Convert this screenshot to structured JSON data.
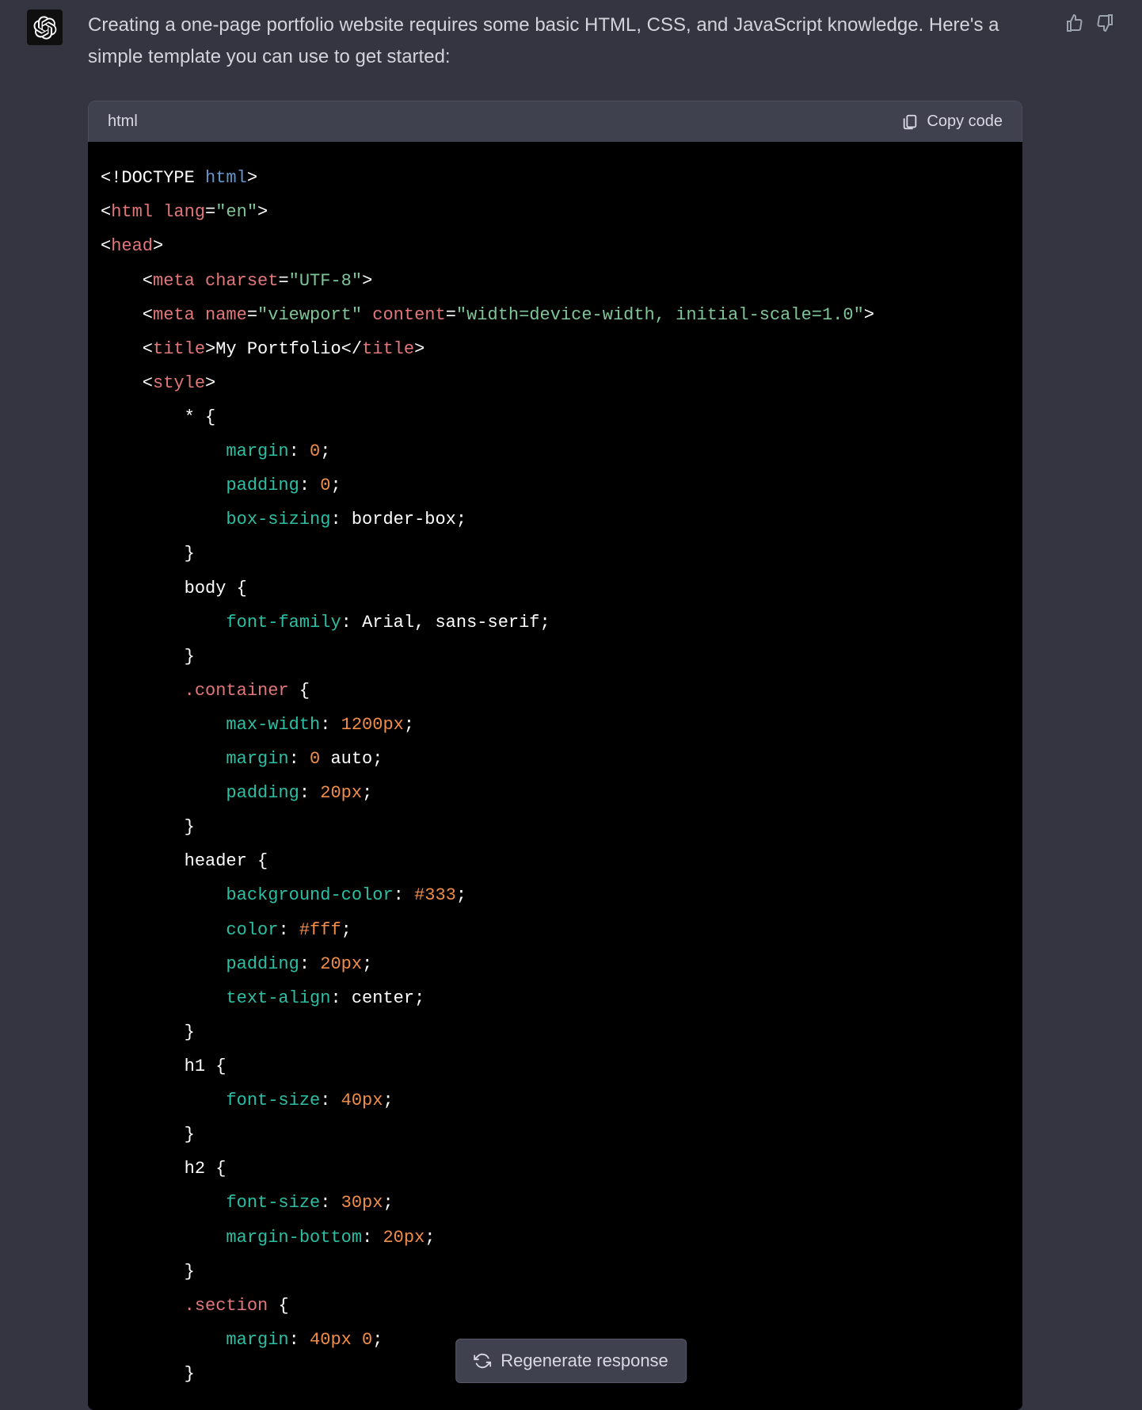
{
  "message": {
    "intro": "Creating a one-page portfolio website requires some basic HTML, CSS, and JavaScript knowledge. Here's a simple template you can use to get started:"
  },
  "code_block": {
    "language": "html",
    "copy_label": "Copy code",
    "lines": {
      "l1_doctype": "<!DOCTYPE",
      "l1_html": " html",
      "l1_end": ">",
      "l2_open": "<",
      "l2_tag": "html",
      "l2_attr": " lang",
      "l2_eq": "=",
      "l2_val": "\"en\"",
      "l2_close": ">",
      "l3_open": "<",
      "l3_tag": "head",
      "l3_close": ">",
      "l4_open": "    <",
      "l4_tag": "meta",
      "l4_attr": " charset",
      "l4_eq": "=",
      "l4_val": "\"UTF-8\"",
      "l4_close": ">",
      "l5_open": "    <",
      "l5_tag": "meta",
      "l5_attr1": " name",
      "l5_eq1": "=",
      "l5_val1": "\"viewport\"",
      "l5_attr2": " content",
      "l5_eq2": "=",
      "l5_val2": "\"width=device-width, initial-scale=1.0\"",
      "l5_close": ">",
      "l6_open": "    <",
      "l6_tag": "title",
      "l6_close1": ">",
      "l6_text": "My Portfolio",
      "l6_open2": "</",
      "l6_tag2": "title",
      "l6_close2": ">",
      "l7_open": "    <",
      "l7_tag": "style",
      "l7_close": ">",
      "l8_sel": "        * ",
      "l8_brace": "{",
      "l9_prop": "            margin",
      "l9_colon": ": ",
      "l9_val": "0",
      "l9_semi": ";",
      "l10_prop": "            padding",
      "l10_colon": ": ",
      "l10_val": "0",
      "l10_semi": ";",
      "l11_prop": "            box-sizing",
      "l11_colon": ": ",
      "l11_val": "border-box",
      "l11_semi": ";",
      "l12": "        }",
      "l13_sel": "        body ",
      "l13_brace": "{",
      "l14_prop": "            font-family",
      "l14_colon": ": ",
      "l14_val": "Arial, sans-serif",
      "l14_semi": ";",
      "l15": "        }",
      "l16_sel": "        .container ",
      "l16_brace": "{",
      "l17_prop": "            max-width",
      "l17_colon": ": ",
      "l17_val": "1200px",
      "l17_semi": ";",
      "l18_prop": "            margin",
      "l18_colon": ": ",
      "l18_val1": "0",
      "l18_val2": " auto",
      "l18_semi": ";",
      "l19_prop": "            padding",
      "l19_colon": ": ",
      "l19_val": "20px",
      "l19_semi": ";",
      "l20": "        }",
      "l21_sel": "        header ",
      "l21_brace": "{",
      "l22_prop": "            background-color",
      "l22_colon": ": ",
      "l22_val": "#333",
      "l22_semi": ";",
      "l23_prop": "            color",
      "l23_colon": ": ",
      "l23_val": "#fff",
      "l23_semi": ";",
      "l24_prop": "            padding",
      "l24_colon": ": ",
      "l24_val": "20px",
      "l24_semi": ";",
      "l25_prop": "            text-align",
      "l25_colon": ": ",
      "l25_val": "center",
      "l25_semi": ";",
      "l26": "        }",
      "l27_sel": "        h1 ",
      "l27_brace": "{",
      "l28_prop": "            font-size",
      "l28_colon": ": ",
      "l28_val": "40px",
      "l28_semi": ";",
      "l29": "        }",
      "l30_sel": "        h2 ",
      "l30_brace": "{",
      "l31_prop": "            font-size",
      "l31_colon": ": ",
      "l31_val": "30px",
      "l31_semi": ";",
      "l32_prop": "            margin-bottom",
      "l32_colon": ": ",
      "l32_val": "20px",
      "l32_semi": ";",
      "l33": "        }",
      "l34_sel": "        .section ",
      "l34_brace": "{",
      "l35_prop": "            margin",
      "l35_colon": ": ",
      "l35_val1": "40px",
      "l35_val2": " 0",
      "l35_semi": ";",
      "l36": "        }"
    }
  },
  "actions": {
    "regenerate": "Regenerate response"
  }
}
